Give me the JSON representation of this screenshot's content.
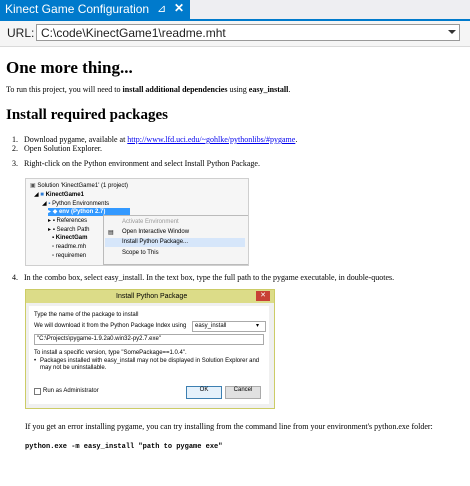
{
  "tab": {
    "title": "Kinect Game Configuration",
    "pin_glyph": "⊿",
    "close_glyph": "✕"
  },
  "url": {
    "label": "URL:",
    "value": "C:\\code\\KinectGame1\\readme.mht"
  },
  "doc": {
    "h1": "One more thing...",
    "intro_pre": "To run this project, you will need to ",
    "intro_bold1": "install additional dependencies",
    "intro_mid": " using ",
    "intro_bold2": "easy_install",
    "intro_post": ".",
    "h2": "Install required packages",
    "step1_num": "1.",
    "step1_pre": "Download pygame, available at ",
    "step1_link": "http://www.lfd.uci.edu/~gohlke/pythonlibs/#pygame",
    "step1_post": ".",
    "step2_num": "2.",
    "step2_text": "Open Solution Explorer.",
    "step3_num": "3.",
    "step3_text": "Right-click on the Python environment and select Install Python Package.",
    "step4_num": "4.",
    "step4_text": "In the combo box, select easy_install. In the text box, type the full path to the pygame executable, in double-quotes.",
    "err_text": "If you get an error installing pygame, you can try installing from the command line from your environment's python.exe folder:",
    "cmd": "python.exe -m easy_install \"path to pygame exe\""
  },
  "shot1": {
    "solution": "Solution 'KinectGame1' (1 project)",
    "project": "KinectGame1",
    "envs": "Python Environments",
    "env": "env (Python 2.7)",
    "refs": "References",
    "search": "Search Path",
    "kinectgame": "KinectGam",
    "readme": "readme.mh",
    "requirements": "requiremen",
    "menu": [
      "Activate Environment",
      "Open Interactive Window",
      "Install Python Package...",
      "Scope to This"
    ]
  },
  "shot2": {
    "title": "Install Python Package",
    "prompt": "Type the name of the package to install",
    "download_label": "We will download it from the Python Package Index using",
    "combo_value": "easy_install",
    "path_value": "\"C:\\Projects\\pygame-1.9.2a0.win32-py2.7.exe\"",
    "hint": "To install a specific version, type \"SomePackage==1.0.4\".",
    "note1": "Packages installed with easy_install may not be displayed in Solution Explorer and",
    "note2": "may not be uninstallable.",
    "admin_label": "Run as Administrator",
    "ok": "OK",
    "cancel": "Cancel"
  },
  "colors": {
    "accent": "#007acc",
    "dialog_border": "#cccc66",
    "link": "#0000ee"
  }
}
